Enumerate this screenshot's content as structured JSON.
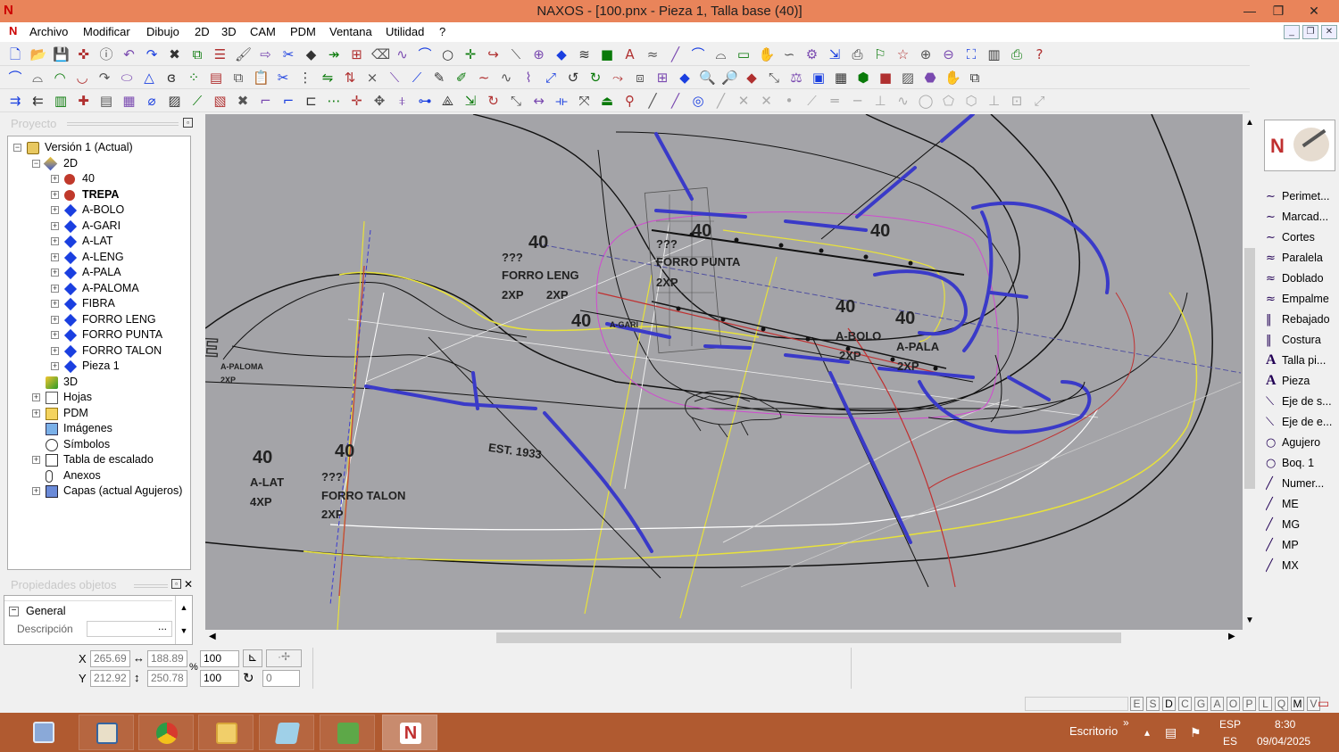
{
  "window": {
    "title": "NAXOS - [100.pnx - Pieza 1, Talla base (40)]",
    "logo": "N"
  },
  "menu": [
    "Archivo",
    "Modificar",
    "Dibujo",
    "2D",
    "3D",
    "CAM",
    "PDM",
    "Ventana",
    "Utilidad",
    "?"
  ],
  "project": {
    "header": "Proyecto",
    "tree": [
      {
        "label": "Versión 1 (Actual)",
        "level": 0,
        "icon": "version-icon",
        "expander": "−"
      },
      {
        "label": "2D",
        "level": 1,
        "icon": "2d-folder-icon",
        "expander": "−"
      },
      {
        "label": "40",
        "level": 2,
        "icon": "red-dot",
        "expander": "+"
      },
      {
        "label": "TREPA",
        "level": 2,
        "icon": "red-dot",
        "expander": "+",
        "bold": true
      },
      {
        "label": "A-BOLO",
        "level": 2,
        "icon": "blue-diamond",
        "expander": "+"
      },
      {
        "label": "A-GARI",
        "level": 2,
        "icon": "blue-diamond",
        "expander": "+"
      },
      {
        "label": "A-LAT",
        "level": 2,
        "icon": "blue-diamond",
        "expander": "+"
      },
      {
        "label": "A-LENG",
        "level": 2,
        "icon": "blue-diamond",
        "expander": "+"
      },
      {
        "label": "A-PALA",
        "level": 2,
        "icon": "blue-diamond",
        "expander": "+"
      },
      {
        "label": "A-PALOMA",
        "level": 2,
        "icon": "blue-diamond",
        "expander": "+"
      },
      {
        "label": "FIBRA",
        "level": 2,
        "icon": "blue-diamond",
        "expander": "+"
      },
      {
        "label": "FORRO LENG",
        "level": 2,
        "icon": "blue-diamond",
        "expander": "+"
      },
      {
        "label": "FORRO PUNTA",
        "level": 2,
        "icon": "blue-diamond",
        "expander": "+"
      },
      {
        "label": "FORRO TALON",
        "level": 2,
        "icon": "blue-diamond",
        "expander": "+"
      },
      {
        "label": "Pieza 1",
        "level": 2,
        "icon": "blue-diamond",
        "expander": "+"
      },
      {
        "label": "3D",
        "level": 1,
        "icon": "3d-icon",
        "expander": ""
      },
      {
        "label": "Hojas",
        "level": 1,
        "icon": "sheets-icon",
        "expander": "+"
      },
      {
        "label": "PDM",
        "level": 1,
        "icon": "pdm-icon",
        "expander": "+"
      },
      {
        "label": "Imágenes",
        "level": 1,
        "icon": "images-icon",
        "expander": ""
      },
      {
        "label": "Símbolos",
        "level": 1,
        "icon": "symbols-icon",
        "expander": ""
      },
      {
        "label": "Tabla de escalado",
        "level": 1,
        "icon": "table-icon",
        "expander": "+"
      },
      {
        "label": "Anexos",
        "level": 1,
        "icon": "attachment-icon",
        "expander": ""
      },
      {
        "label": "Capas (actual Agujeros)",
        "level": 1,
        "icon": "layers-icon",
        "expander": "+"
      }
    ]
  },
  "properties": {
    "header": "Propiedades objetos",
    "group": "General",
    "field": "Descripción",
    "field_btn": "..."
  },
  "canvas_labels": [
    {
      "t": "40",
      "k": "big"
    },
    {
      "t": "40",
      "k": "big"
    },
    {
      "t": "???",
      "k": "mid"
    },
    {
      "t": "FORRO PUNTA",
      "k": "mid"
    },
    {
      "t": "2XP",
      "k": "mid"
    },
    {
      "t": "40",
      "k": "big"
    },
    {
      "t": "???",
      "k": "mid"
    },
    {
      "t": "FORRO LENG",
      "k": "mid"
    },
    {
      "t": "2XP",
      "k": "mid"
    },
    {
      "t": "2XP",
      "k": "mid"
    },
    {
      "t": "40",
      "k": "big"
    },
    {
      "t": "A-GARI",
      "k": "small"
    },
    {
      "t": "40",
      "k": "big"
    },
    {
      "t": "A-BOLO",
      "k": "mid"
    },
    {
      "t": "2XP",
      "k": "mid"
    },
    {
      "t": "40",
      "k": "big"
    },
    {
      "t": "A-PALA",
      "k": "mid"
    },
    {
      "t": "2XP",
      "k": "mid"
    },
    {
      "t": "40",
      "k": "big"
    },
    {
      "t": "40",
      "k": "big"
    },
    {
      "t": "2XP",
      "k": "mid"
    },
    {
      "t": "A-PALOMA",
      "k": "small"
    },
    {
      "t": "2XP",
      "k": "small"
    },
    {
      "t": "40",
      "k": "big"
    },
    {
      "t": "A-LAT",
      "k": "mid"
    },
    {
      "t": "4XP",
      "k": "mid"
    },
    {
      "t": "40",
      "k": "big"
    },
    {
      "t": "???",
      "k": "mid"
    },
    {
      "t": "FORRO TALON",
      "k": "mid"
    },
    {
      "t": "2XP",
      "k": "mid"
    },
    {
      "t": "EST. 1933",
      "k": "mid"
    },
    {
      "t": "LACOSTE",
      "k": "logo"
    }
  ],
  "right_panel": [
    {
      "label": "Perimet...",
      "icon": "perimeter-icon"
    },
    {
      "label": "Marcad...",
      "icon": "marker-icon"
    },
    {
      "label": "Cortes",
      "icon": "cuts-icon"
    },
    {
      "label": "Paralela",
      "icon": "parallel-icon"
    },
    {
      "label": "Doblado",
      "icon": "fold-icon"
    },
    {
      "label": "Empalme",
      "icon": "joint-icon"
    },
    {
      "label": "Rebajado",
      "icon": "skive-icon"
    },
    {
      "label": "Costura",
      "icon": "seam-icon"
    },
    {
      "label": "Talla pi...",
      "icon": "text-icon"
    },
    {
      "label": "Pieza",
      "icon": "text-icon"
    },
    {
      "label": "Eje de s...",
      "icon": "axis-icon"
    },
    {
      "label": "Eje de e...",
      "icon": "axis-icon"
    },
    {
      "label": "Agujero",
      "icon": "hole-icon"
    },
    {
      "label": "Boq. 1",
      "icon": "hole-icon"
    },
    {
      "label": "Numer...",
      "icon": "number-icon"
    },
    {
      "label": "ME",
      "icon": "me-icon"
    },
    {
      "label": "MG",
      "icon": "mg-icon"
    },
    {
      "label": "MP",
      "icon": "mp-icon"
    },
    {
      "label": "MX",
      "icon": "mx-icon"
    }
  ],
  "coords": {
    "x_label": "X",
    "y_label": "Y",
    "x": "265.69",
    "y": "212.92",
    "w": "188.89",
    "h": "250.78",
    "sx": "100",
    "sy": "100",
    "pct": "%",
    "angle": "0"
  },
  "status_keys": [
    "E",
    "S",
    "D",
    "C",
    "G",
    "A",
    "O",
    "P",
    "L",
    "Q",
    "M",
    "V"
  ],
  "taskbar": {
    "desktop": "Escritorio",
    "lang1": "ESP",
    "lang2": "ES",
    "time": "8:30",
    "date": "09/04/2025",
    "chevron": "»",
    "up": "▴"
  },
  "colors": {
    "canvas": "#a4a4a8",
    "titlebar": "#e9845a",
    "taskbar": "#b05a30",
    "accent_blue": "#3a3ac8"
  }
}
